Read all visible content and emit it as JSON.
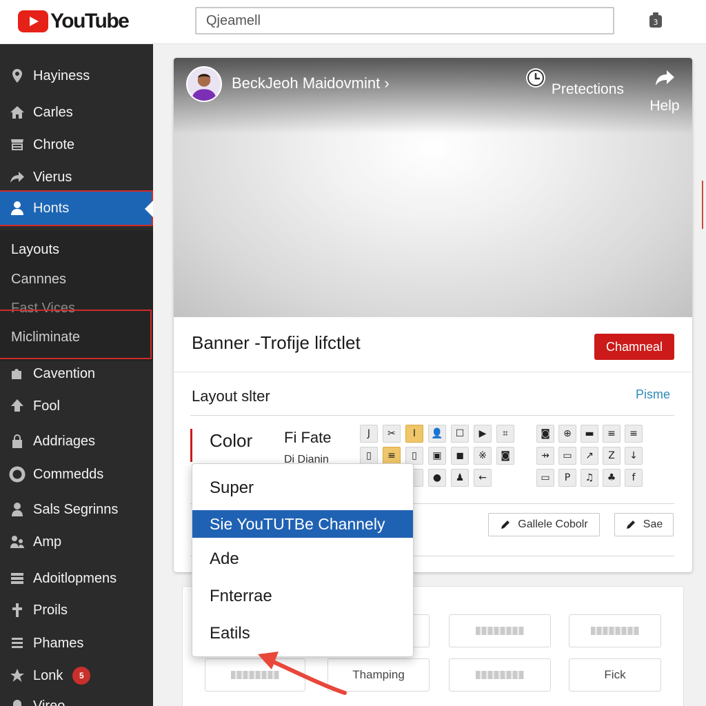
{
  "header": {
    "logo_text": "YouTube",
    "search_placeholder": "Qjeamell"
  },
  "sidebar": {
    "items": [
      {
        "label": "Hayiness",
        "icon": "map-pin-icon"
      },
      {
        "label": "Carles",
        "icon": "home-icon"
      },
      {
        "label": "Chrote",
        "icon": "store-icon"
      },
      {
        "label": "Vierus",
        "icon": "share-icon"
      },
      {
        "label": "Honts",
        "icon": "person-icon",
        "active": true
      },
      {
        "label": "Cavention",
        "icon": "puzzle-icon"
      },
      {
        "label": "Fool",
        "icon": "upload-icon"
      },
      {
        "label": "Addriages",
        "icon": "lock-icon"
      },
      {
        "label": "Commedds",
        "icon": "ring-icon"
      },
      {
        "label": "Sals Segrinns",
        "icon": "user-icon"
      },
      {
        "label": "Amp",
        "icon": "people-icon"
      },
      {
        "label": "Adoitlopmens",
        "icon": "layers-icon"
      },
      {
        "label": "Proils",
        "icon": "tools-icon"
      },
      {
        "label": "Phames",
        "icon": "list-icon"
      },
      {
        "label": "Lonk",
        "icon": "star-icon",
        "badge": "5"
      },
      {
        "label": "Vireo",
        "icon": "bell-icon"
      }
    ],
    "subitems": [
      "Layouts",
      "Cannnes",
      "Fast Vices",
      "Micliminate"
    ]
  },
  "channel": {
    "name": "BeckJeoh Maidovmint ›",
    "actions": [
      {
        "label": "Pretections",
        "icon": "clock-icon"
      },
      {
        "label": "Help",
        "icon": "share-arrow-icon"
      }
    ]
  },
  "banner": {
    "title": "Banner -Trofije lifctlet",
    "button_label": "Chamneal"
  },
  "layout": {
    "title": "Layout slter",
    "link": "Pisme",
    "row_label": "Color",
    "row_value": "Fi Fate",
    "row_value2": "Di Dianin",
    "tools_left": [
      "J",
      "✂",
      "I",
      "👤",
      "☐",
      "▶",
      "⌗",
      "▯",
      "≡",
      "▯",
      "▣",
      "◼",
      "※",
      "◙",
      "",
      "",
      "",
      "●",
      "♟",
      "←"
    ],
    "tools_right": [
      "◙",
      "⊕",
      "▬",
      "≡",
      "≡",
      "⇸",
      "▭",
      "↗",
      "Z",
      "↓",
      "▭",
      "P",
      "♫",
      "♣",
      "f"
    ],
    "button_gallery": "Gallele Cobolr",
    "button_save": "Sae"
  },
  "dropdown": {
    "items": [
      "Super",
      "Sie YouTUTBe Channely",
      "Ade",
      "Fnterrae",
      "Eatils"
    ],
    "selected_index": 1
  },
  "tiles": {
    "labels": [
      "Thamping",
      "Fick"
    ]
  },
  "colors": {
    "accent_red": "#cc1a1a",
    "selection_blue": "#1f62b3",
    "sidebar_bg": "#2b2b2b",
    "active_blue": "#1c65b5",
    "link_blue": "#2e8ab8"
  }
}
